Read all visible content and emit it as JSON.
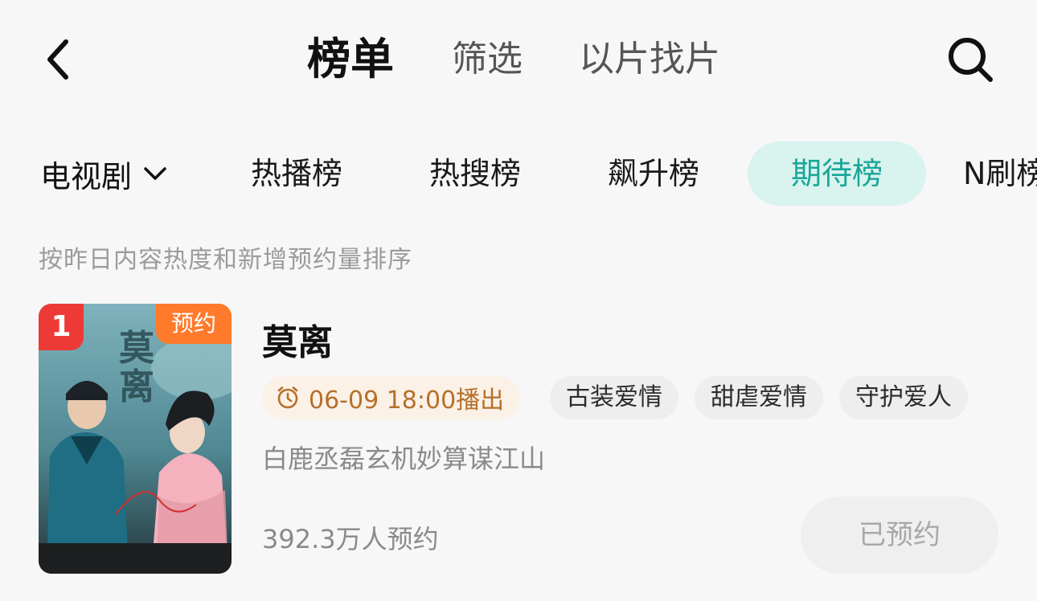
{
  "header": {
    "tabs": [
      {
        "label": "榜单",
        "active": true
      },
      {
        "label": "筛选",
        "active": false
      },
      {
        "label": "以片找片",
        "active": false
      }
    ],
    "back_icon": "chevron-left-icon",
    "search_icon": "search-icon"
  },
  "category": {
    "selected": "电视剧",
    "dropdown_icon": "chevron-down-icon"
  },
  "rank_tabs": [
    {
      "label": "热播榜",
      "active": false
    },
    {
      "label": "热搜榜",
      "active": false
    },
    {
      "label": "飙升榜",
      "active": false
    },
    {
      "label": "期待榜",
      "active": true
    },
    {
      "label": "N刷榜",
      "active": false
    }
  ],
  "sort_description": "按昨日内容热度和新增预约量排序",
  "items": [
    {
      "rank": "1",
      "poster_badge": "预约",
      "poster_title_chars": [
        "莫",
        "离"
      ],
      "title": "莫离",
      "air_time": "06-09 18:00播出",
      "tags": [
        "古装爱情",
        "甜虐爱情",
        "守护爱人"
      ],
      "description": "白鹿丞磊玄机妙算谋江山",
      "reserve_count": "392.3万人预约",
      "reserve_button": "已预约"
    }
  ],
  "colors": {
    "accent": "#1aa699",
    "accent_bg": "#d9f3ef",
    "rank_badge": "#ee3a36",
    "reserve_badge": "#ff7a2a",
    "air_time_text": "#b5702c",
    "air_time_bg": "#fbf1e6"
  }
}
